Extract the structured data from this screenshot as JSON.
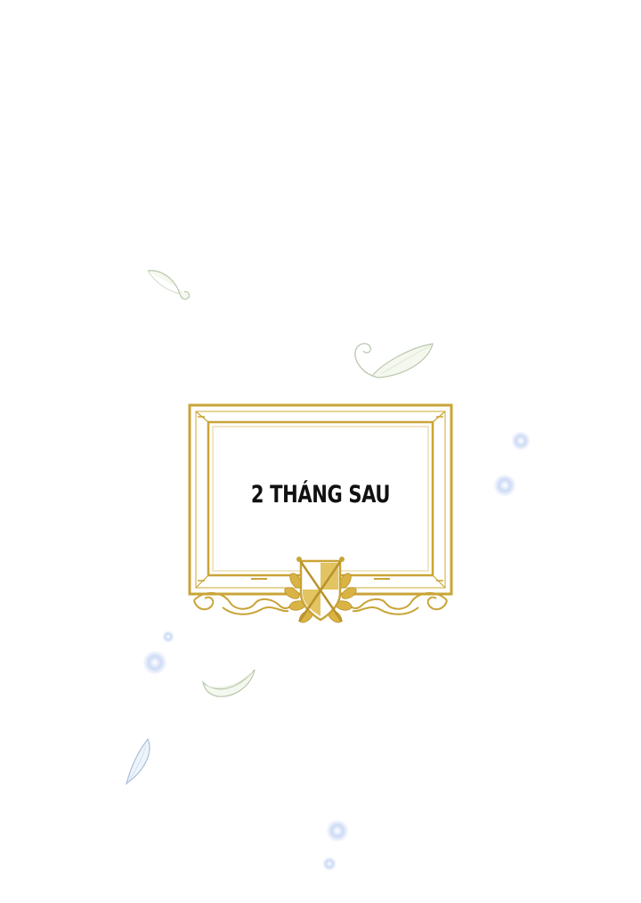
{
  "caption": {
    "text": "2 THÁNG SAU"
  },
  "colors": {
    "frame_gold": "#c9a437",
    "frame_gold_light": "#e0c26a",
    "background": "#ffffff",
    "text": "#111111",
    "petal_fill": "#f4f8ee",
    "petal_edge": "#b9c7ad",
    "sparkle": "#c8d7f5"
  }
}
